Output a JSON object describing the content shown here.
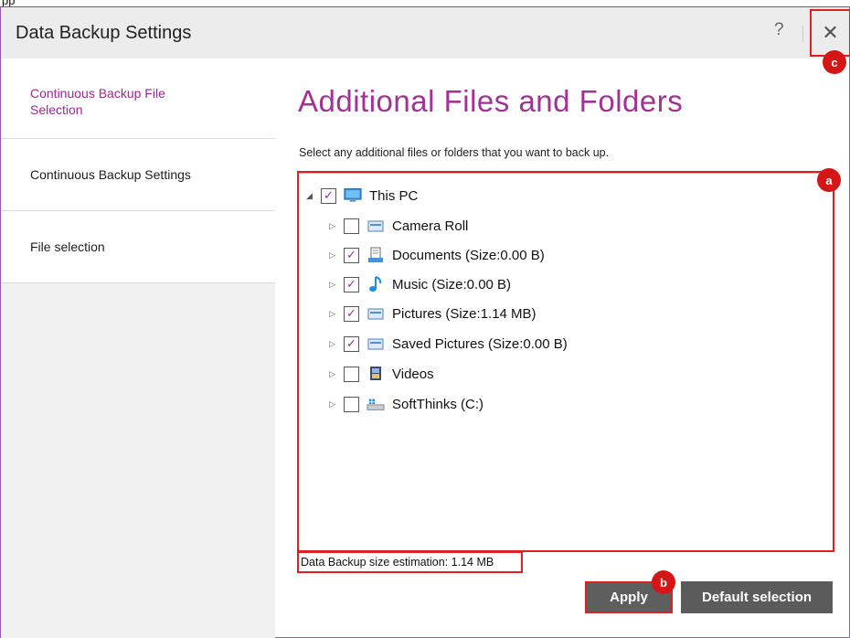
{
  "top_strip_text": "pp",
  "window": {
    "title": "Data Backup Settings",
    "help_label": "?",
    "close_label": "✕"
  },
  "sidebar": {
    "items": [
      {
        "label": "Continuous Backup File Selection",
        "active": true
      },
      {
        "label": "Continuous Backup Settings",
        "active": false
      },
      {
        "label": "File selection",
        "active": false
      }
    ]
  },
  "main": {
    "heading": "Additional Files and Folders",
    "description": "Select any additional files or folders that you want to back up.",
    "tree": {
      "root": {
        "label": "This PC",
        "checked": true,
        "expanded": true,
        "icon": "monitor-icon"
      },
      "children": [
        {
          "label": "Camera Roll",
          "checked": false,
          "icon": "folder-icon"
        },
        {
          "label": "Documents (Size:0.00 B)",
          "checked": true,
          "icon": "documents-icon"
        },
        {
          "label": "Music (Size:0.00 B)",
          "checked": true,
          "icon": "music-icon"
        },
        {
          "label": "Pictures (Size:1.14 MB)",
          "checked": true,
          "icon": "folder-icon"
        },
        {
          "label": "Saved Pictures (Size:0.00 B)",
          "checked": true,
          "icon": "folder-icon"
        },
        {
          "label": "Videos",
          "checked": false,
          "icon": "videos-icon"
        },
        {
          "label": "SoftThinks (C:)",
          "checked": false,
          "icon": "drive-icon"
        }
      ]
    },
    "size_estimation": "Data Backup size estimation: 1.14 MB",
    "buttons": {
      "apply": "Apply",
      "default_selection": "Default selection"
    }
  },
  "markers": {
    "a": "a",
    "b": "b",
    "c": "c"
  },
  "colors": {
    "accent": "#a23394",
    "highlight": "#e02020",
    "button": "#5b5b5b"
  }
}
